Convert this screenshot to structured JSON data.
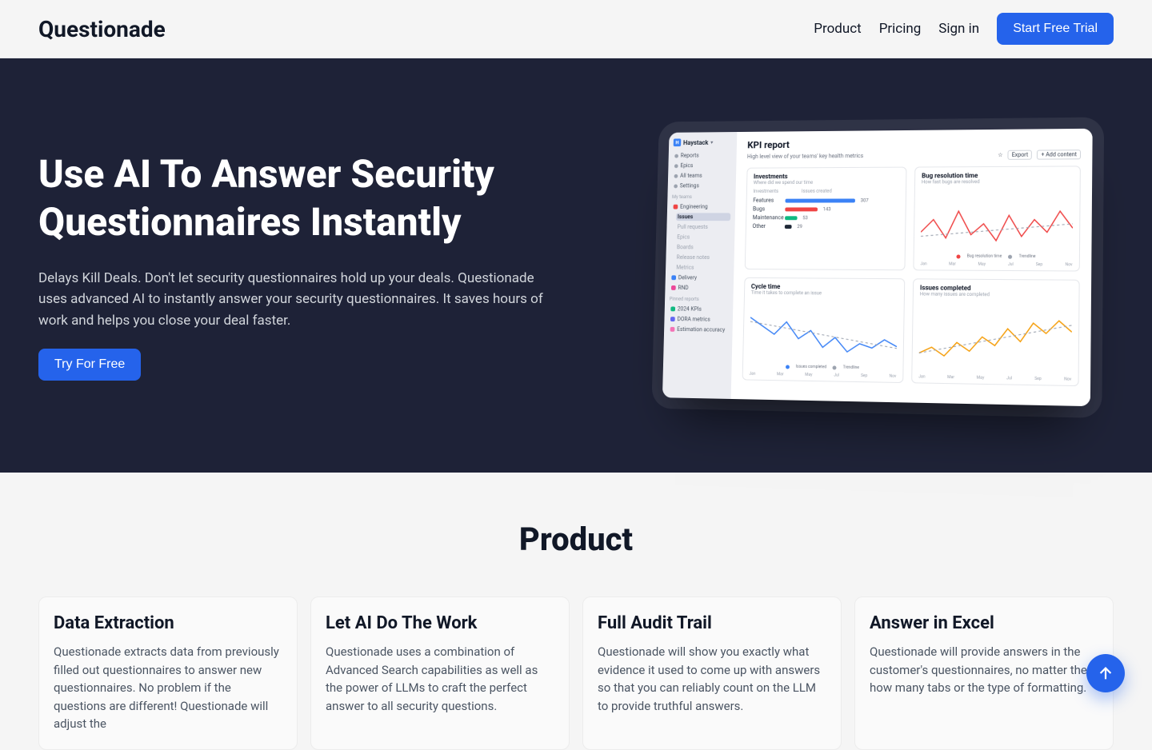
{
  "brand": "Questionade",
  "nav": {
    "product": "Product",
    "pricing": "Pricing",
    "signin": "Sign in",
    "cta": "Start Free Trial"
  },
  "hero": {
    "title": "Use AI To Answer Security Questionnaires Instantly",
    "body": "Delays Kill Deals. Don't let security questionnaires hold up your deals. Questionade uses advanced AI to instantly answer your security questionnaires. It saves hours of work and helps you close your deal faster.",
    "cta": "Try For Free"
  },
  "dashboard": {
    "brand": "Haystack",
    "nav": {
      "reports": "Reports",
      "epics": "Epics",
      "allteams": "All teams",
      "settings": "Settings"
    },
    "sections": {
      "myteams": "My teams",
      "pinned": "Pinned reports"
    },
    "teams": {
      "engineering": "Engineering",
      "issues": "Issues",
      "pullrequests": "Pull requests",
      "epics2": "Epics",
      "boards": "Boards",
      "releasenotes": "Release notes",
      "metrics": "Metrics",
      "delivery": "Delivery",
      "rnd": "RND"
    },
    "pinned": {
      "kpis": "2024 KPIs",
      "dora": "DORA metrics",
      "estimation": "Estimation accuracy"
    },
    "main": {
      "title": "KPI report",
      "subtitle": "High level view of your teams' key health metrics",
      "actions": {
        "export": "Export",
        "add": "+  Add content",
        "star": "☆"
      }
    },
    "panels": {
      "investments": {
        "title": "Investments",
        "sub": "Where did we spend our time",
        "col1": "Investments",
        "col2": "Issues created",
        "rows": {
          "features": {
            "label": "Features",
            "val": "307"
          },
          "bugs": {
            "label": "Bugs",
            "val": "143"
          },
          "maint": {
            "label": "Maintenance",
            "val": "53"
          },
          "other": {
            "label": "Other",
            "val": "29"
          }
        }
      },
      "bugres": {
        "title": "Bug resolution time",
        "sub": "How fast bugs are resolved",
        "legend": {
          "a": "Bug resolution time",
          "b": "Trendline"
        }
      },
      "cycle": {
        "title": "Cycle time",
        "sub": "Time it takes to complete an issue",
        "legend": {
          "a": "Issues completed",
          "b": "Trendline"
        }
      },
      "completed": {
        "title": "Issues completed",
        "sub": "How many issues are completed"
      },
      "months": {
        "jan": "Jan",
        "mar": "Mar",
        "may": "May",
        "jul": "Jul",
        "sep": "Sep",
        "nov": "Nov"
      }
    }
  },
  "product": {
    "heading": "Product",
    "cards": {
      "extract": {
        "title": "Data Extraction",
        "body": "Questionade extracts data from previously filled out questionnaires to answer new questionnaires. No problem if the questions are different! Questionade will adjust the"
      },
      "ai": {
        "title": "Let AI Do The Work",
        "body": "Questionade uses a combination of Advanced Search capabilities as well as the power of LLMs to craft the perfect answer to all security questions."
      },
      "audit": {
        "title": "Full Audit Trail",
        "body": "Questionade will show you exactly what evidence it used to come up with answers so that you can reliably count on the LLM to provide truthful answers."
      },
      "excel": {
        "title": "Answer in Excel",
        "body": "Questionade will provide answers in the customer's questionnaires, no matter the how many tabs or the type of formatting."
      }
    }
  }
}
